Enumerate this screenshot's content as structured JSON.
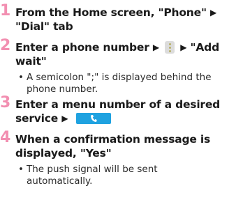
{
  "steps": [
    {
      "number": "1",
      "line1_a": "From the Home screen, \"Phone\"",
      "arrow": "▶",
      "line2": "\"Dial\" tab"
    },
    {
      "number": "2",
      "line1_a": "Enter a phone number",
      "arrow": "▶",
      "line1_b": "\"Add",
      "line2": "wait\"",
      "note_line1": "A semicolon \";\" is displayed behind the",
      "note_line2": "phone number.",
      "icon": "menu-icon"
    },
    {
      "number": "3",
      "line1": "Enter a menu number of a desired",
      "line2_a": "service",
      "arrow": "▶",
      "icon": "call-button-icon"
    },
    {
      "number": "4",
      "line1": "When a confirmation message is",
      "line2": "displayed, \"Yes\"",
      "note_line1": "The push signal will be sent",
      "note_line2": "automatically."
    }
  ],
  "colors": {
    "step_number": "#f28fb1",
    "call_button": "#1fa2e0"
  }
}
